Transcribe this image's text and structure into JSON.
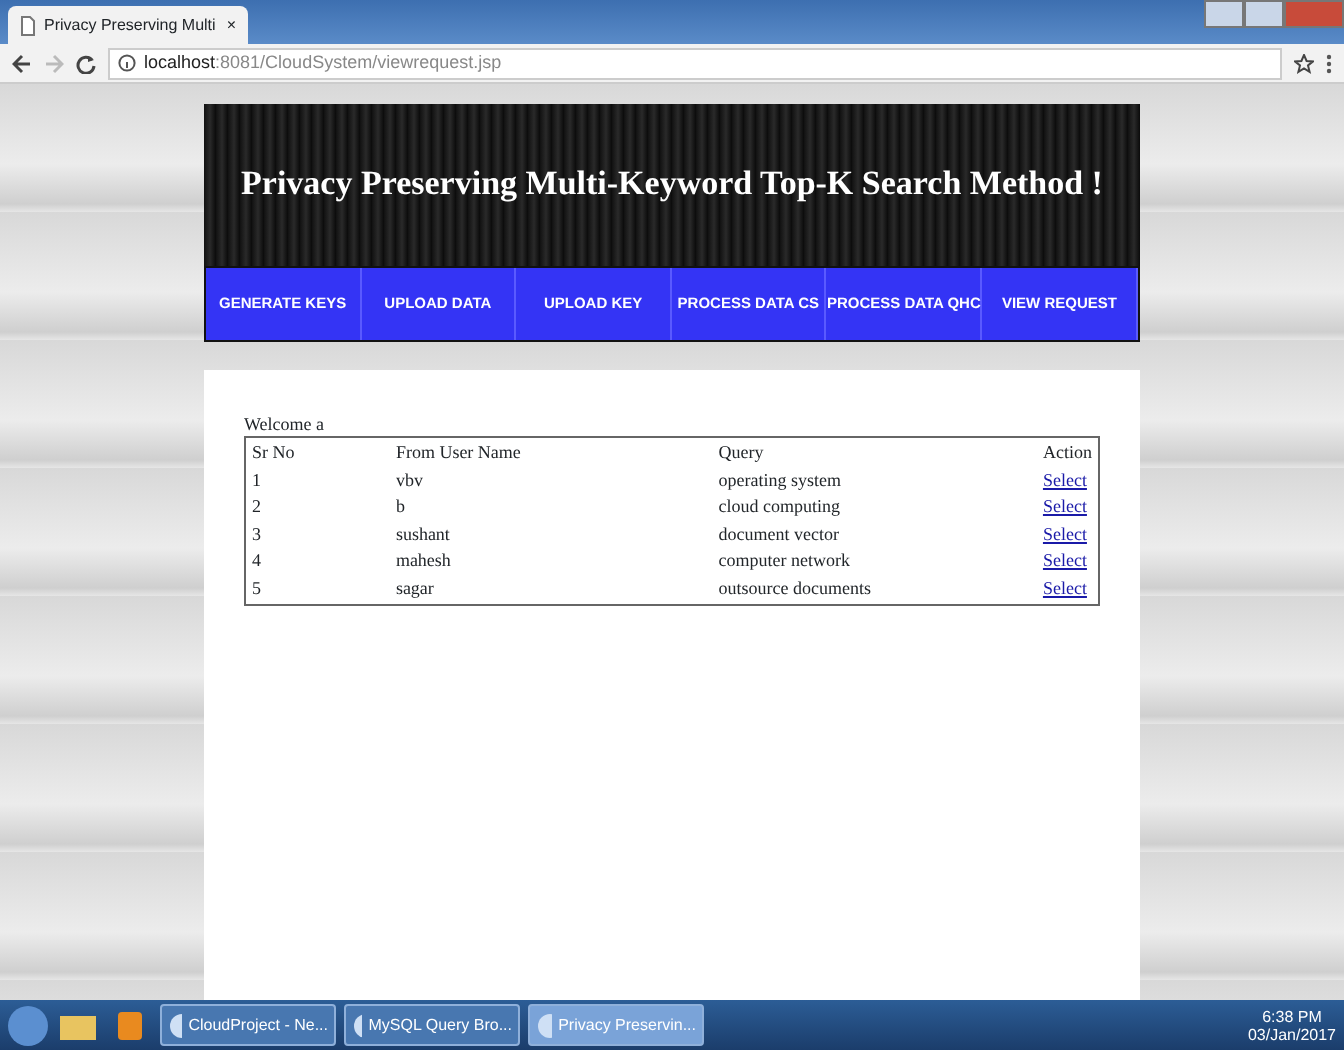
{
  "browser": {
    "tab_title": "Privacy Preserving Multi",
    "tab_close": "×",
    "address_host": "localhost",
    "address_rest": ":8081/CloudSystem/viewrequest.jsp"
  },
  "header": {
    "title": "Privacy Preserving Multi-Keyword Top-K Search Method !"
  },
  "nav": [
    "GENERATE KEYS",
    "UPLOAD DATA",
    "UPLOAD KEY",
    "PROCESS DATA CS",
    "PROCESS DATA QHC",
    "VIEW REQUEST"
  ],
  "welcome": "Welcome a",
  "table": {
    "columns": [
      "Sr No",
      "From User Name",
      "Query",
      "Action"
    ],
    "rows": [
      {
        "sr": "1",
        "user": "vbv",
        "query": "operating system",
        "action": "Select"
      },
      {
        "sr": "2",
        "user": "b",
        "query": "cloud computing",
        "action": "Select"
      },
      {
        "sr": "3",
        "user": "sushant",
        "query": "document vector",
        "action": "Select"
      },
      {
        "sr": "4",
        "user": "mahesh",
        "query": "computer network",
        "action": "Select"
      },
      {
        "sr": "5",
        "user": "sagar",
        "query": "outsource documents",
        "action": "Select"
      }
    ]
  },
  "taskbar": {
    "items": [
      {
        "label": "CloudProject - Ne...",
        "selected": false
      },
      {
        "label": "MySQL Query Bro...",
        "selected": false
      },
      {
        "label": "Privacy Preservin...",
        "selected": true
      }
    ],
    "time": "6:38 PM",
    "date": "03/Jan/2017"
  }
}
